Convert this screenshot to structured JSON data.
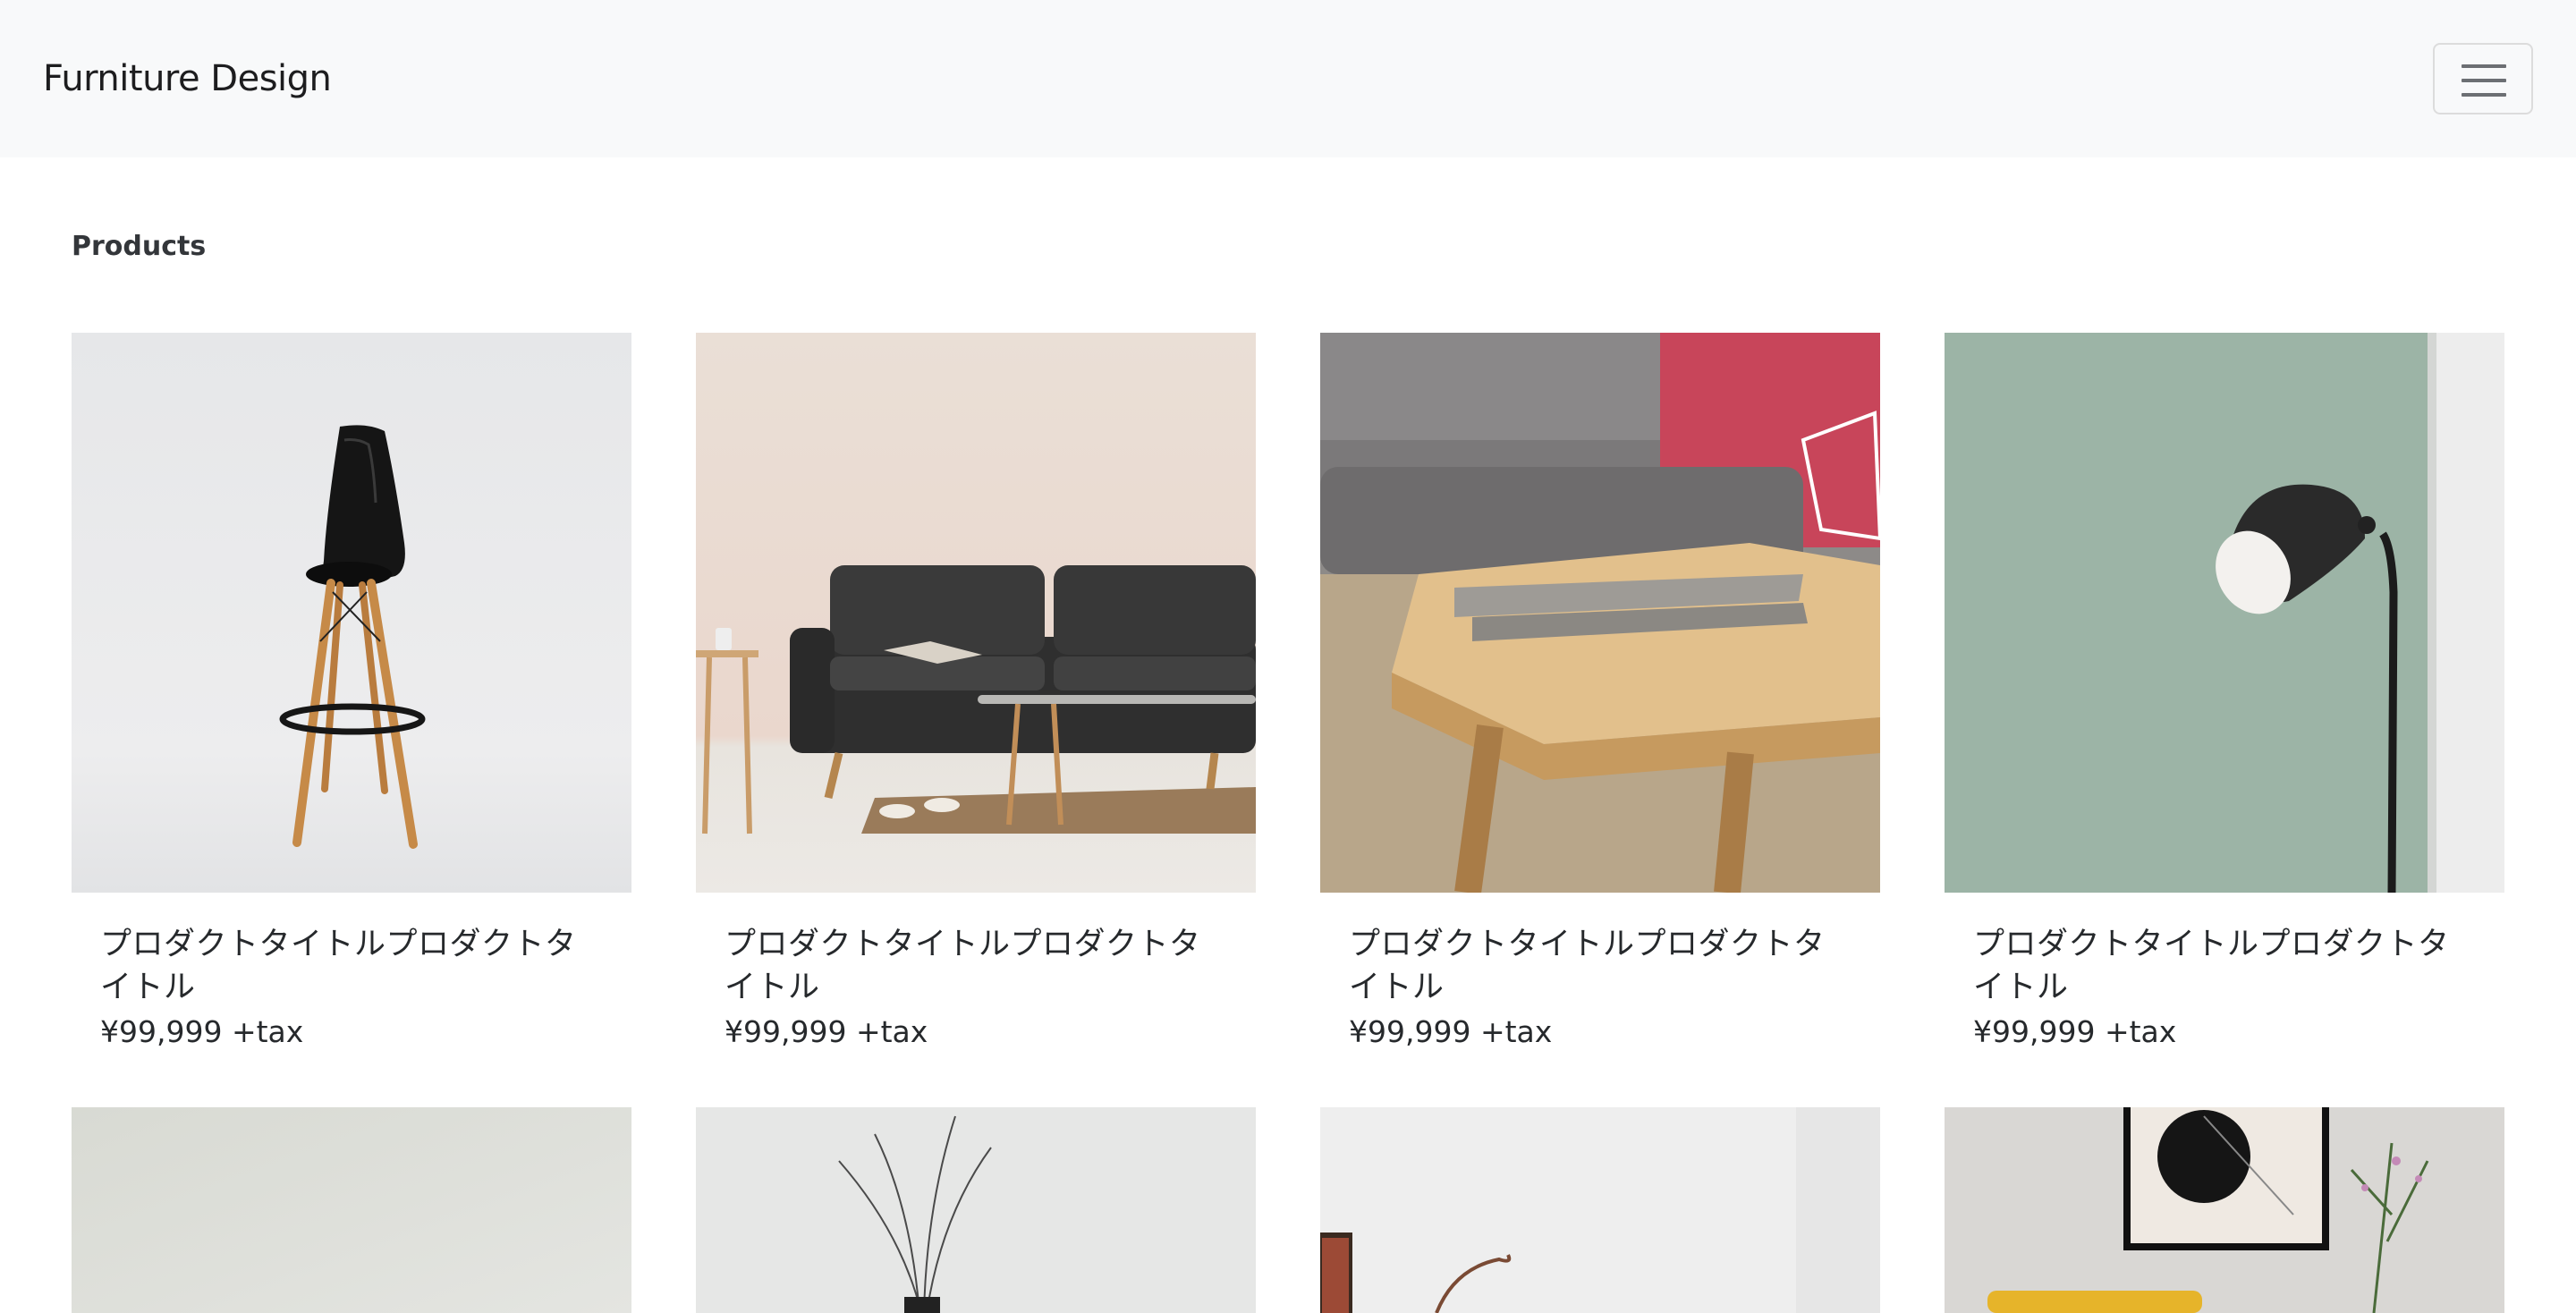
{
  "navbar": {
    "brand": "Furniture Design",
    "toggle_icon": "hamburger-menu-icon"
  },
  "main": {
    "section_title": "Products",
    "products": [
      {
        "title": "プロダクトタイトルプロダクトタイトル",
        "price": "¥99,999 +tax",
        "image": "bar-stool-photo"
      },
      {
        "title": "プロダクトタイトルプロダクトタイトル",
        "price": "¥99,999 +tax",
        "image": "sofa-photo"
      },
      {
        "title": "プロダクトタイトルプロダクトタイトル",
        "price": "¥99,999 +tax",
        "image": "coffee-table-photo"
      },
      {
        "title": "プロダクトタイトルプロダクトタイトル",
        "price": "¥99,999 +tax",
        "image": "floor-lamp-photo"
      }
    ],
    "next_row_images": [
      "wall-photo",
      "plant-vase-photo",
      "shelf-decor-photo",
      "framed-art-photo"
    ]
  },
  "colors": {
    "navbar_bg": "#f8f9fa",
    "page_bg": "#ffffff",
    "text": "#212529"
  }
}
